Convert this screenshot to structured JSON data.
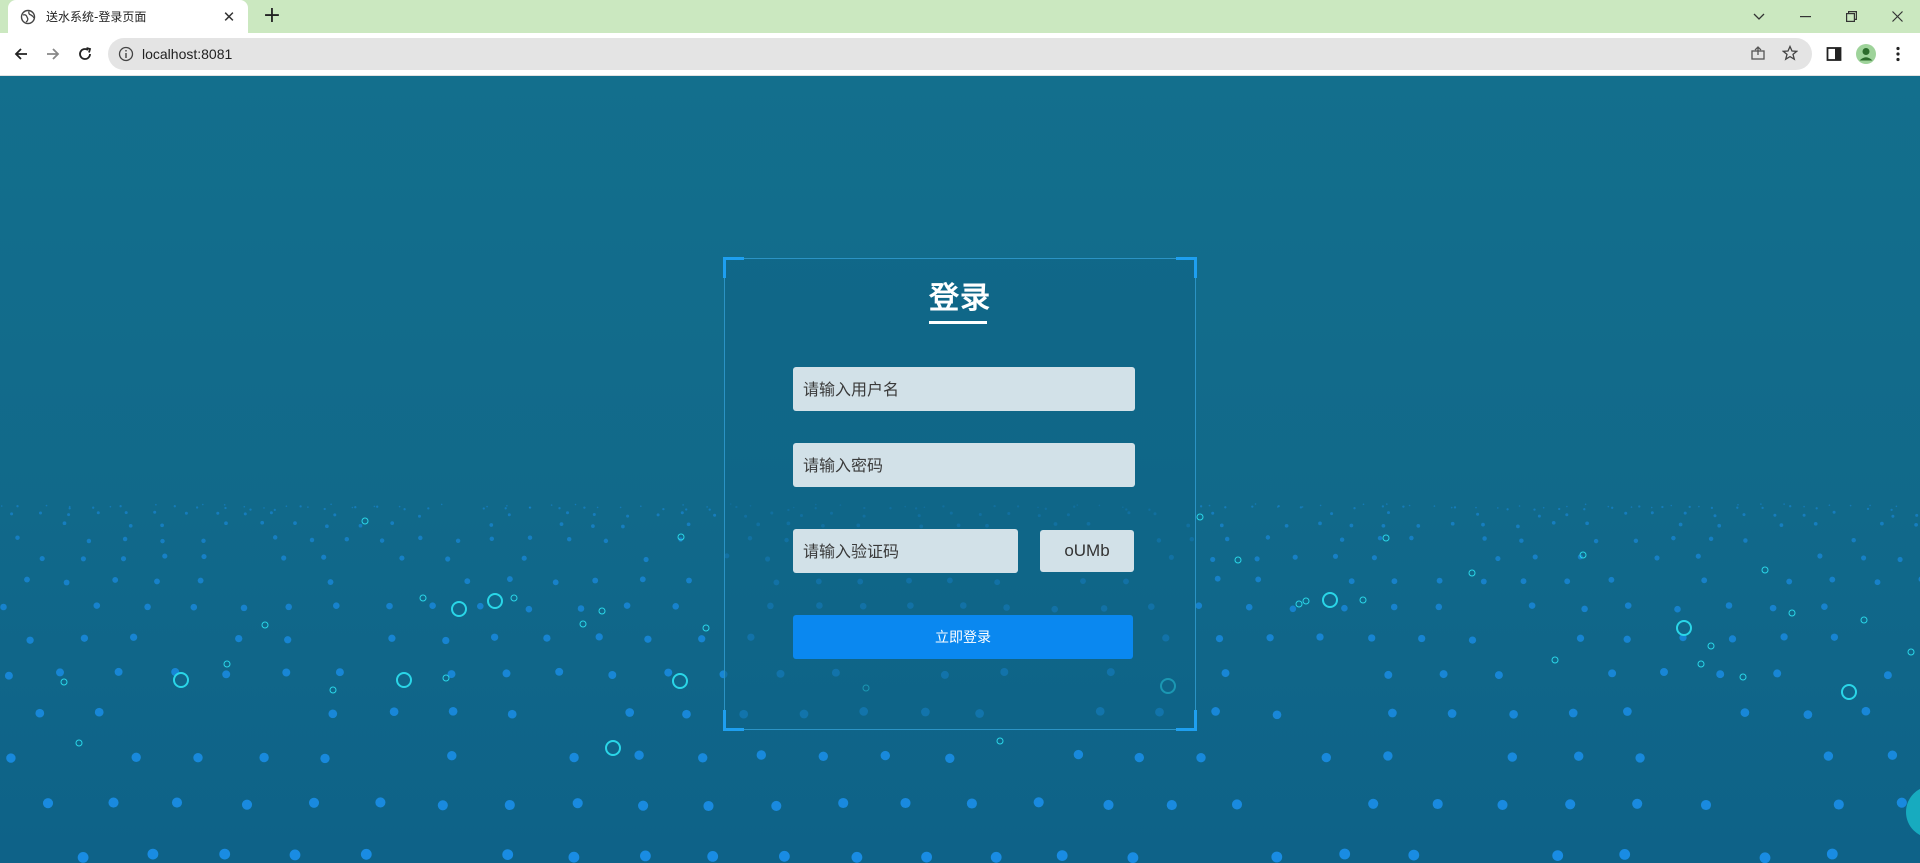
{
  "browser": {
    "tab_title": "送水系统-登录页面",
    "url": "localhost:8081",
    "tabbar_color": "#cbe8c0"
  },
  "login": {
    "title": "登录",
    "username_placeholder": "请输入用户名",
    "password_placeholder": "请输入密码",
    "captcha_placeholder": "请输入验证码",
    "captcha_text": "oUMb",
    "submit_label": "立即登录"
  },
  "colors": {
    "background": "#11698a",
    "accent": "#0a88f0",
    "glow": "#1fd3f0"
  }
}
